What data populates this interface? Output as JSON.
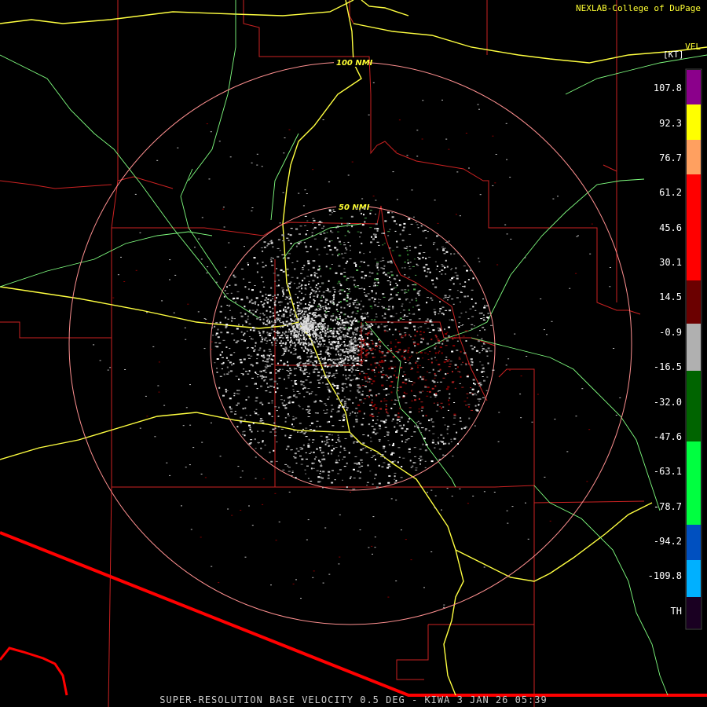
{
  "header": {
    "credit": "NEXLAB-College of DuPage",
    "product_code": "VEL"
  },
  "range_rings": [
    {
      "label": "100 NMI"
    },
    {
      "label": "50 NMI"
    }
  ],
  "legend": {
    "unit": "[KT]",
    "ticks": [
      "107.8",
      "92.3",
      "76.7",
      "61.2",
      "45.6",
      "30.1",
      "14.5",
      "-0.9",
      "-16.5",
      "-32.0",
      "-47.6",
      "-63.1",
      "-78.7",
      "-94.2",
      "-109.8",
      "TH"
    ],
    "colors": {
      "purple": "#8b008b",
      "yellow": "#ffff00",
      "orange": "#ffa060",
      "red": "#ff0000",
      "dark_red": "#6b0000",
      "gray": "#b0b0b0",
      "dark_green": "#006400",
      "green": "#00ff40",
      "blue": "#0050c0",
      "light_blue": "#00b0ff",
      "th": "#300040"
    }
  },
  "map_colors": {
    "county": "#cc2222",
    "state_border": "#ff0000",
    "highway": "#ffff40",
    "road": "#80ff80",
    "ring": "#ff9090"
  },
  "footer": {
    "caption": "SUPER-RESOLUTION BASE VELOCITY 0.5 DEG - KIWA 3 JAN 26 05:39"
  }
}
